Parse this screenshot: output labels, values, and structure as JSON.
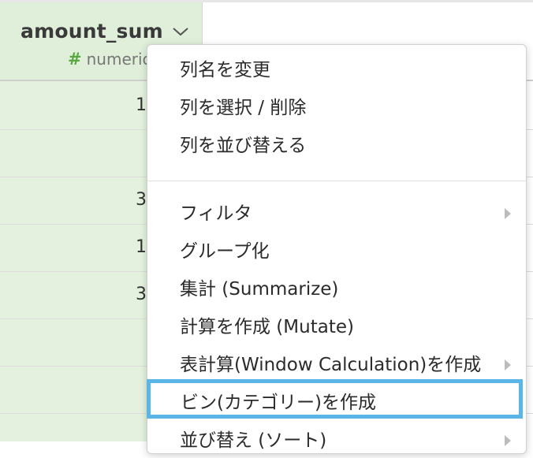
{
  "column": {
    "title": "amount_sum",
    "type_label": "numeric",
    "type_icon": "hash-icon",
    "type_color": "#59a83f",
    "header_color": "#dfefd9"
  },
  "cells": [
    "1",
    "",
    "3",
    "1",
    "3",
    "",
    ""
  ],
  "menu": {
    "group1": [
      {
        "label": "列名を変更"
      },
      {
        "label": "列を選択 / 削除"
      },
      {
        "label": "列を並び替える"
      }
    ],
    "group2": [
      {
        "label": "フィルタ",
        "has_submenu": true
      },
      {
        "label": "グループ化",
        "has_submenu": false
      },
      {
        "label": "集計 (Summarize)",
        "has_submenu": false
      },
      {
        "label": "計算を作成 (Mutate)",
        "has_submenu": false
      },
      {
        "label": "表計算(Window Calculation)を作成",
        "has_submenu": true
      },
      {
        "label": "ビン(カテゴリー)を作成",
        "has_submenu": false,
        "highlighted": true
      },
      {
        "label": "並び替え (ソート)",
        "has_submenu": true
      }
    ]
  },
  "highlight_color": "#5bb6e8"
}
